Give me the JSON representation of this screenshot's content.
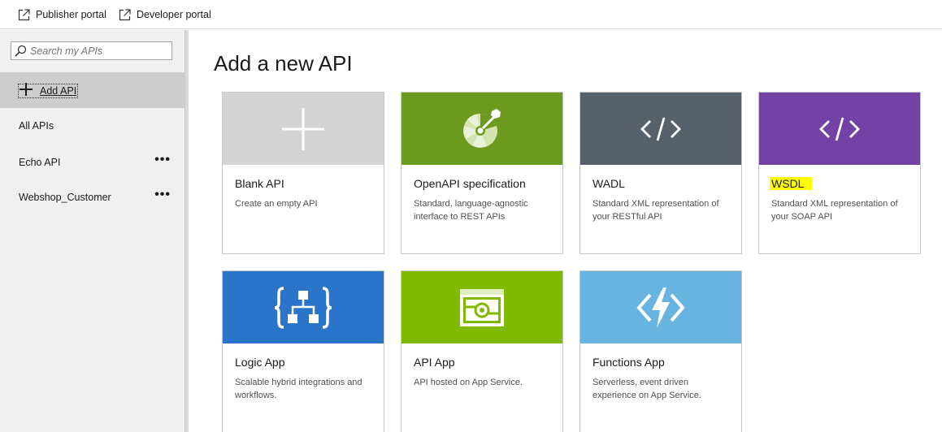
{
  "topbar": {
    "publisher_label": "Publisher portal",
    "developer_label": "Developer portal"
  },
  "sidebar": {
    "search_placeholder": "Search my APIs",
    "add_label": "Add API",
    "items": [
      {
        "label": "All APIs",
        "has_menu": false
      },
      {
        "label": "Echo API",
        "has_menu": true,
        "menu": "•••"
      },
      {
        "label": "Webshop_Customer",
        "has_menu": true,
        "menu": "•••"
      }
    ]
  },
  "main": {
    "title": "Add a new API",
    "tiles": [
      {
        "name": "Blank API",
        "desc": "Create an empty API",
        "icon": "plus-icon",
        "color": "#d4d4d4"
      },
      {
        "name": "OpenAPI specification",
        "desc": "Standard, language-agnostic interface to REST APIs",
        "icon": "openapi-icon",
        "color": "#6b9a1f"
      },
      {
        "name": "WADL",
        "desc": "Standard XML representation of your RESTful API",
        "icon": "code-icon",
        "color": "#56616b"
      },
      {
        "name": "WSDL",
        "desc": "Standard XML representation of your SOAP API",
        "icon": "code-icon",
        "color": "#7243a4",
        "highlighted": true
      },
      {
        "name": "Logic App",
        "desc": "Scalable hybrid integrations and workflows.",
        "icon": "logic-app-icon",
        "color": "#2a74c9"
      },
      {
        "name": "API App",
        "desc": "API hosted on App Service.",
        "icon": "api-app-icon",
        "color": "#7fba00"
      },
      {
        "name": "Functions App",
        "desc": "Serverless, event driven experience on App Service.",
        "icon": "functions-icon",
        "color": "#68b4e0"
      }
    ]
  }
}
